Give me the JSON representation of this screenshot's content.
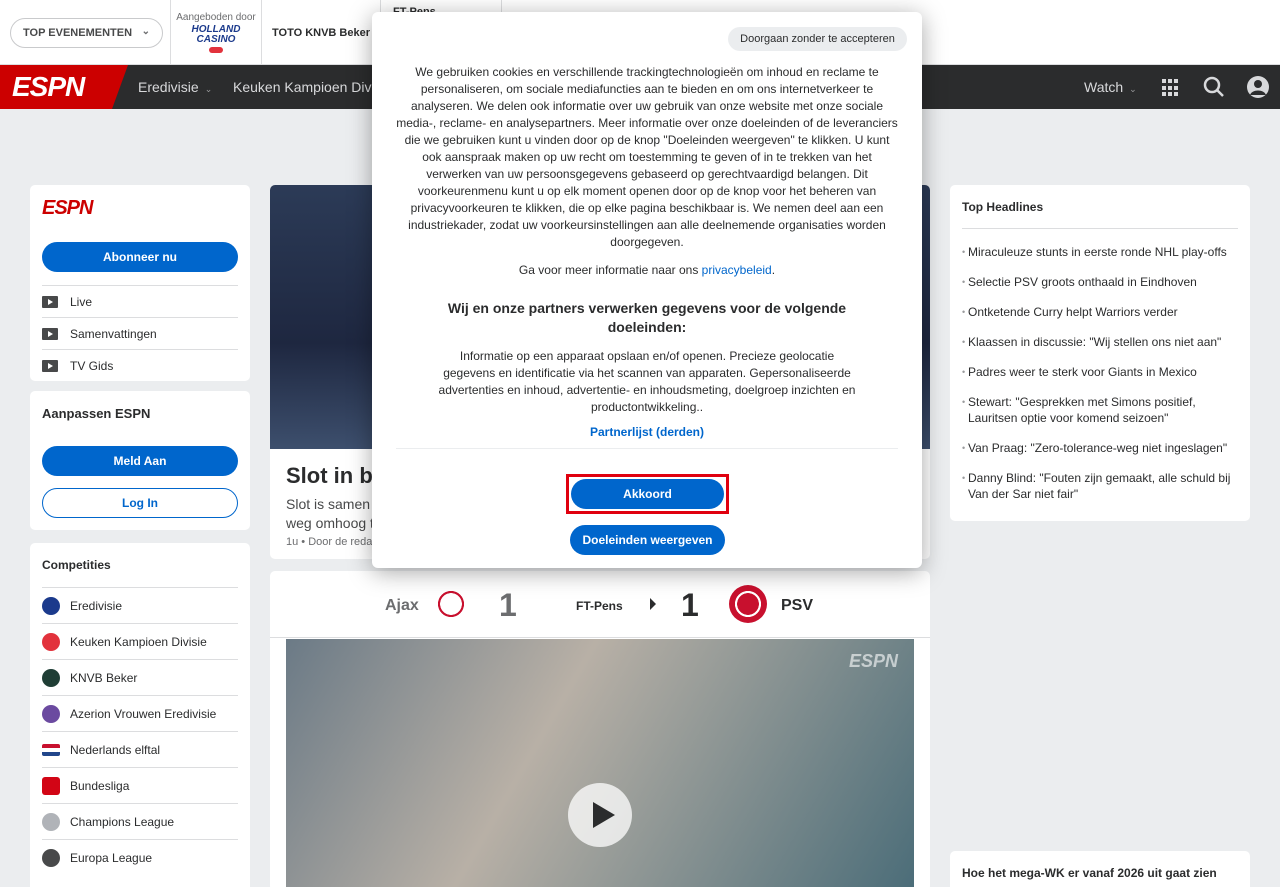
{
  "topbar": {
    "top_events": "TOP EVENEMENTEN",
    "sponsor_by": "Aangeboden door",
    "sponsor_logo_line1": "HOLLAND",
    "sponsor_logo_line2": "CASINO",
    "toto": "TOTO KNVB Beker",
    "score_tab": "FT-Pens"
  },
  "nav": {
    "logo": "ESPN",
    "items": [
      "Eredivisie",
      "Keuken Kampioen Div"
    ],
    "watch": "Watch"
  },
  "left": {
    "logo": "ESPN",
    "subscribe": "Abonneer nu",
    "links": [
      "Live",
      "Samenvattingen",
      "TV Gids"
    ],
    "customize_title": "Aanpassen ESPN",
    "signup": "Meld Aan",
    "login": "Log In",
    "competitions_title": "Competities",
    "competitions": [
      {
        "label": "Eredivisie",
        "color": "#1b3a8c"
      },
      {
        "label": "Keuken Kampioen Divisie",
        "color": "#e2323c"
      },
      {
        "label": "KNVB Beker",
        "color": "#1f3e35"
      },
      {
        "label": "Azerion Vrouwen Eredivisie",
        "color": "#6b4aa0"
      },
      {
        "label": "Nederlands elftal",
        "color": "#c8102e"
      },
      {
        "label": "Bundesliga",
        "color": "#d20515"
      },
      {
        "label": "Champions League",
        "color": "#b0b3b8"
      },
      {
        "label": "Europa League",
        "color": "#48494a"
      }
    ]
  },
  "hero": {
    "title": "Slot in b",
    "subtitle": "Slot is samen weg omhoog t",
    "meta": "1u • Door de reda"
  },
  "match": {
    "home": "Ajax",
    "home_score": "1",
    "status": "FT-Pens",
    "away_score": "1",
    "away": "PSV",
    "video_logo": "ESPN"
  },
  "right": {
    "headlines_title": "Top Headlines",
    "headlines": [
      "Miraculeuze stunts in eerste ronde NHL play-offs",
      "Selectie PSV groots onthaald in Eindhoven",
      "Ontketende Curry helpt Warriors verder",
      "Klaassen in discussie: \"Wij stellen ons niet aan\"",
      "Padres weer te sterk voor Giants in Mexico",
      "Stewart: \"Gesprekken met Simons positief, Lauritsen optie voor komend seizoen\"",
      "Van Praag: \"Zero-tolerance-weg niet ingeslagen\"",
      "Danny Blind: \"Fouten zijn gemaakt, alle schuld bij Van der Sar niet fair\""
    ],
    "wk_title": "Hoe het mega-WK er vanaf 2026 uit gaat zien"
  },
  "modal": {
    "skip": "Doorgaan zonder te accepteren",
    "body": "We gebruiken cookies en verschillende trackingtechnologieën om inhoud en reclame te personaliseren, om sociale mediafuncties aan te bieden en om ons internetverkeer te analyseren. We delen ook informatie over uw gebruik van onze website met onze sociale media-, reclame- en analysepartners. Meer informatie over onze doeleinden of de leveranciers die we gebruiken kunt u vinden door op de knop \"Doeleinden weergeven\" te klikken. U kunt ook aanspraak maken op uw recht om toestemming te geven of in te trekken van het verwerken van uw persoonsgegevens gebaseerd op gerechtvaardigd belangen. Dit voorkeurenmenu kunt u op elk moment openen door op de knop voor het beheren van privacyvoorkeuren te klikken, die op elke pagina beschikbaar is. We nemen deel aan een industriekader, zodat uw voorkeursinstellingen aan alle deelnemende organisaties worden doorgegeven.",
    "more_prefix": "Ga voor meer informatie naar ons ",
    "more_link": "privacybeleid",
    "more_suffix": ".",
    "heading": "Wij en onze partners verwerken gegevens voor de volgende doeleinden:",
    "purposes": "Informatie op een apparaat opslaan en/of openen. Precieze geolocatie gegevens en identificatie via het scannen van apparaten. Gepersonaliseerde advertenties en inhoud, advertentie- en inhoudsmeting, doelgroep inzichten en productontwikkeling..",
    "partners": "Partnerlijst (derden)",
    "accept": "Akkoord",
    "show_purposes": "Doeleinden weergeven"
  }
}
